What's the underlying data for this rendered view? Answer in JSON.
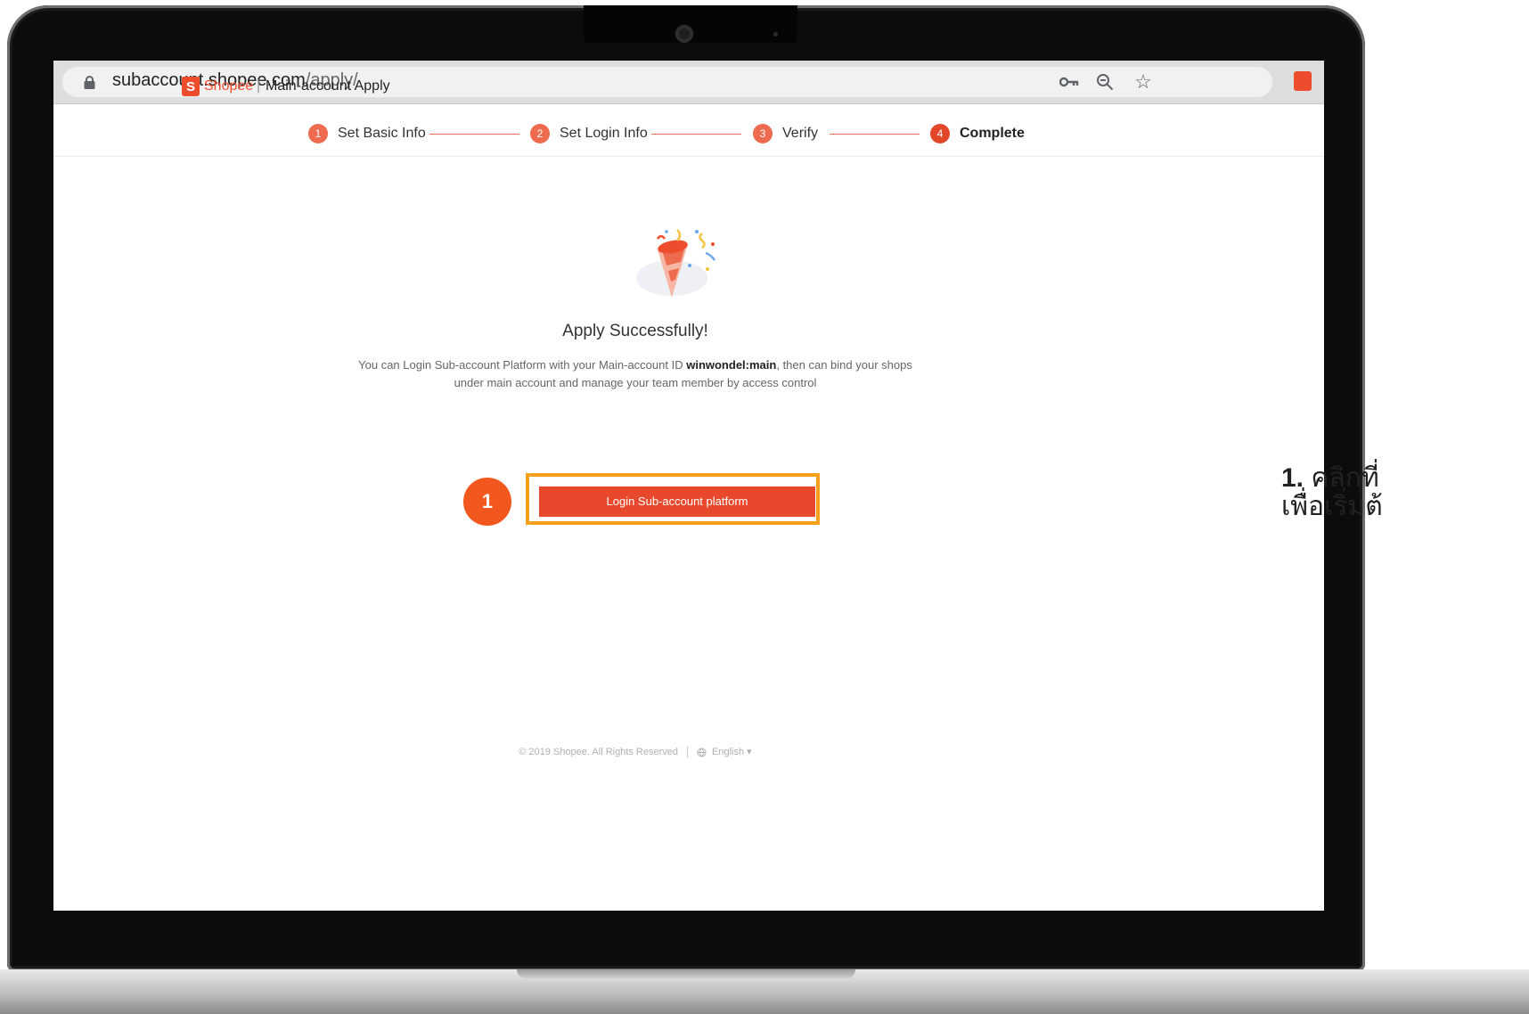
{
  "browser": {
    "url_domain": "subaccount.shopee.com",
    "url_path": "/apply/",
    "icons": [
      "lock-icon",
      "key-icon",
      "zoom-out-icon",
      "star-icon",
      "shopee-extension-icon"
    ]
  },
  "header": {
    "brand": "Shopee",
    "separator": "|",
    "title": "Main-account Apply"
  },
  "stepper": {
    "steps": [
      {
        "number": "1",
        "label": "Set Basic Info",
        "active": false
      },
      {
        "number": "2",
        "label": "Set Login Info",
        "active": false
      },
      {
        "number": "3",
        "label": "Verify",
        "active": false
      },
      {
        "number": "4",
        "label": "Complete",
        "active": true
      }
    ]
  },
  "success": {
    "icon": "party-popper-icon",
    "title": "Apply Successfully!",
    "desc_before": "You can Login Sub-account Platform with your Main-account ID ",
    "account_id": "winwondel:main",
    "desc_after": ", then can bind your shops under main account and manage your team member by access control",
    "button_label": "Login Sub-account platform"
  },
  "marker": {
    "number": "1"
  },
  "footer": {
    "copyright": "© 2019 Shopee. All Rights Reserved",
    "language": "English",
    "language_caret": "▾"
  },
  "instruction": {
    "number": "1.",
    "line1": " คลิกที่",
    "line2": "เพื่อเริ่มต้"
  },
  "colors": {
    "brand": "#ee4d2d",
    "button": "#e8482c",
    "highlight": "#f7a01c",
    "step": "#ee6b50"
  }
}
